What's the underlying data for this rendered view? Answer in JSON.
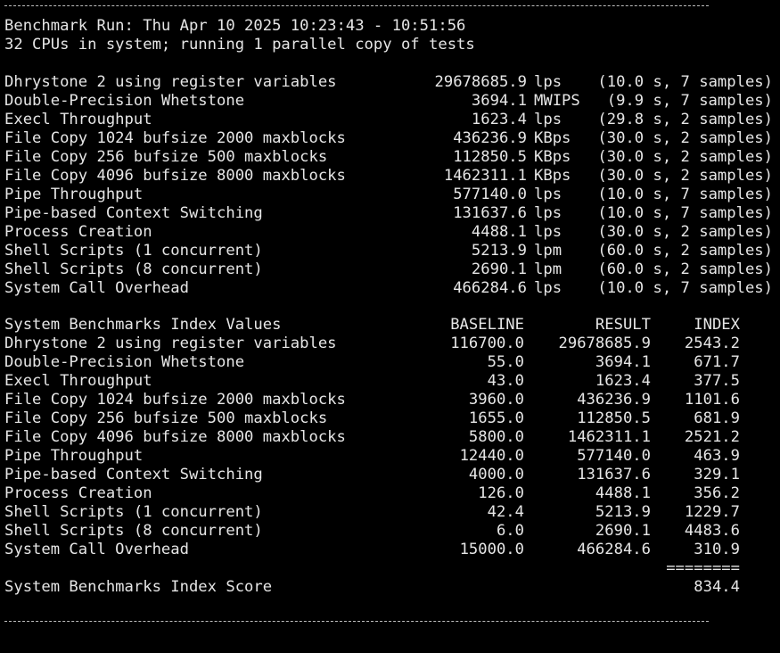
{
  "header": {
    "run_line": "Benchmark Run: Thu Apr 10 2025 10:23:43 - 10:51:56",
    "cpu_line": "32 CPUs in system; running 1 parallel copy of tests"
  },
  "results": [
    {
      "test": "Dhrystone 2 using register variables",
      "value": "29678685.9",
      "unit": "lps",
      "info": "(10.0 s, 7 samples)"
    },
    {
      "test": "Double-Precision Whetstone",
      "value": "3694.1",
      "unit": "MWIPS",
      "info": "(9.9 s, 7 samples)"
    },
    {
      "test": "Execl Throughput",
      "value": "1623.4",
      "unit": "lps",
      "info": "(29.8 s, 2 samples)"
    },
    {
      "test": "File Copy 1024 bufsize 2000 maxblocks",
      "value": "436236.9",
      "unit": "KBps",
      "info": "(30.0 s, 2 samples)"
    },
    {
      "test": "File Copy 256 bufsize 500 maxblocks",
      "value": "112850.5",
      "unit": "KBps",
      "info": "(30.0 s, 2 samples)"
    },
    {
      "test": "File Copy 4096 bufsize 8000 maxblocks",
      "value": "1462311.1",
      "unit": "KBps",
      "info": "(30.0 s, 2 samples)"
    },
    {
      "test": "Pipe Throughput",
      "value": "577140.0",
      "unit": "lps",
      "info": "(10.0 s, 7 samples)"
    },
    {
      "test": "Pipe-based Context Switching",
      "value": "131637.6",
      "unit": "lps",
      "info": "(10.0 s, 7 samples)"
    },
    {
      "test": "Process Creation",
      "value": "4488.1",
      "unit": "lps",
      "info": "(30.0 s, 2 samples)"
    },
    {
      "test": "Shell Scripts (1 concurrent)",
      "value": "5213.9",
      "unit": "lpm",
      "info": "(60.0 s, 2 samples)"
    },
    {
      "test": "Shell Scripts (8 concurrent)",
      "value": "2690.1",
      "unit": "lpm",
      "info": "(60.0 s, 2 samples)"
    },
    {
      "test": "System Call Overhead",
      "value": "466284.6",
      "unit": "lps",
      "info": "(10.0 s, 7 samples)"
    }
  ],
  "index_table": {
    "title": "System Benchmarks Index Values",
    "columns": [
      "BASELINE",
      "RESULT",
      "INDEX"
    ],
    "rows": [
      {
        "test": "Dhrystone 2 using register variables",
        "baseline": "116700.0",
        "result": "29678685.9",
        "index": "2543.2"
      },
      {
        "test": "Double-Precision Whetstone",
        "baseline": "55.0",
        "result": "3694.1",
        "index": "671.7"
      },
      {
        "test": "Execl Throughput",
        "baseline": "43.0",
        "result": "1623.4",
        "index": "377.5"
      },
      {
        "test": "File Copy 1024 bufsize 2000 maxblocks",
        "baseline": "3960.0",
        "result": "436236.9",
        "index": "1101.6"
      },
      {
        "test": "File Copy 256 bufsize 500 maxblocks",
        "baseline": "1655.0",
        "result": "112850.5",
        "index": "681.9"
      },
      {
        "test": "File Copy 4096 bufsize 8000 maxblocks",
        "baseline": "5800.0",
        "result": "1462311.1",
        "index": "2521.2"
      },
      {
        "test": "Pipe Throughput",
        "baseline": "12440.0",
        "result": "577140.0",
        "index": "463.9"
      },
      {
        "test": "Pipe-based Context Switching",
        "baseline": "4000.0",
        "result": "131637.6",
        "index": "329.1"
      },
      {
        "test": "Process Creation",
        "baseline": "126.0",
        "result": "4488.1",
        "index": "356.2"
      },
      {
        "test": "Shell Scripts (1 concurrent)",
        "baseline": "42.4",
        "result": "5213.9",
        "index": "1229.7"
      },
      {
        "test": "Shell Scripts (8 concurrent)",
        "baseline": "6.0",
        "result": "2690.1",
        "index": "4483.6"
      },
      {
        "test": "System Call Overhead",
        "baseline": "15000.0",
        "result": "466284.6",
        "index": "310.9"
      }
    ],
    "separator": "========",
    "score_label": "System Benchmarks Index Score",
    "score_value": "834.4"
  },
  "colors": {
    "background": "#000000",
    "text": "#e6e6e6"
  }
}
